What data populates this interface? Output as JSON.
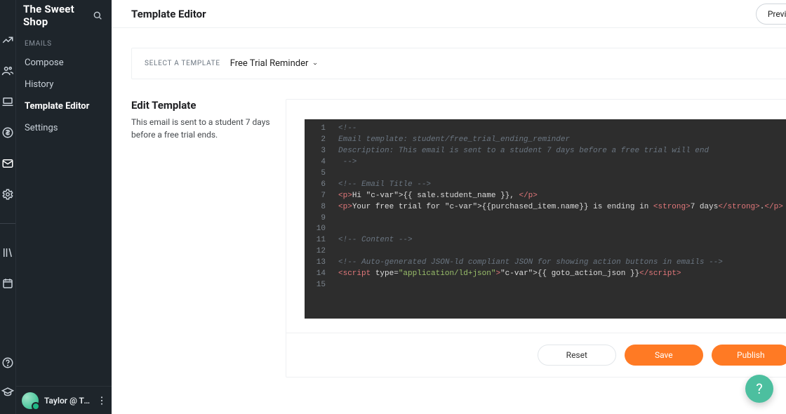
{
  "brand": "The Sweet Shop",
  "header": {
    "title": "Template Editor",
    "preview": "Preview"
  },
  "sidebar": {
    "section": "Emails",
    "items": [
      "Compose",
      "History",
      "Template Editor",
      "Settings"
    ],
    "active": 2
  },
  "user": {
    "name": "Taylor @ Teachable"
  },
  "select": {
    "label": "Select a template",
    "value": "Free Trial Reminder"
  },
  "edit": {
    "title": "Edit Template",
    "desc": "This email is sent to a student 7 days before a free trial ends."
  },
  "code": {
    "lines": 15,
    "content": [
      {
        "t": "comment",
        "s": "<!--"
      },
      {
        "t": "comment",
        "s": "Email template: student/free_trial_ending_reminder"
      },
      {
        "t": "comment",
        "s": "Description: This email is sent to a student 7 days before a free trial will end"
      },
      {
        "t": "comment",
        "s": " -->"
      },
      {
        "t": "",
        "s": ""
      },
      {
        "t": "comment",
        "s": "<!-- Email Title -->"
      },
      {
        "t": "html",
        "s": "<p>Hi {{ sale.student_name }}, </p>"
      },
      {
        "t": "html",
        "s": "<p>Your free trial for {{purchased_item.name}} is ending in <strong>7 days</strong>.</p>"
      },
      {
        "t": "",
        "s": ""
      },
      {
        "t": "",
        "s": ""
      },
      {
        "t": "comment",
        "s": "<!-- Content -->"
      },
      {
        "t": "",
        "s": ""
      },
      {
        "t": "comment",
        "s": "<!-- Auto-generated JSON-ld compliant JSON for showing action buttons in emails -->"
      },
      {
        "t": "html",
        "s": "<script type=\"application/ld+json\">{{ goto_action_json }}</scr_ipt>"
      },
      {
        "t": "",
        "s": ""
      }
    ]
  },
  "buttons": {
    "reset": "Reset",
    "save": "Save",
    "publish": "Publish"
  },
  "fab": "?"
}
